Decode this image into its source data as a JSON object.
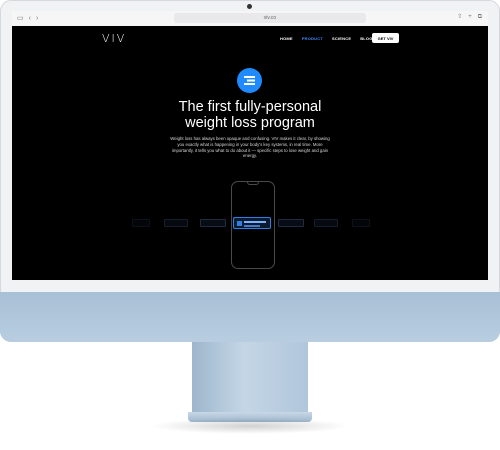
{
  "browser": {
    "url": "viv.co",
    "icons": [
      "sidebar-icon",
      "back-icon",
      "forward-icon",
      "shield-icon",
      "share-icon",
      "plus-icon",
      "tabs-icon"
    ]
  },
  "site": {
    "logo": "VIV",
    "nav": [
      {
        "label": "HOME",
        "active": false
      },
      {
        "label": "PRODUCT",
        "active": true
      },
      {
        "label": "SCIENCE",
        "active": false
      },
      {
        "label": "BLOG",
        "active": false
      }
    ],
    "cta_label": "GET VIV",
    "hero": {
      "title_line1": "The first fully-personal",
      "title_line2": "weight loss program",
      "body": "Weight loss has always been opaque and confusing. VIV makes it clear, by showing you exactly what is happening in your body's key systems, in real time. More importantly, it tells you what to do about it — specific steps to lose weight and gain energy."
    }
  },
  "colors": {
    "accent": "#1f8bff",
    "nav_active": "#3d8cff",
    "background": "#000000",
    "monitor_chin": "#b0c6da"
  }
}
